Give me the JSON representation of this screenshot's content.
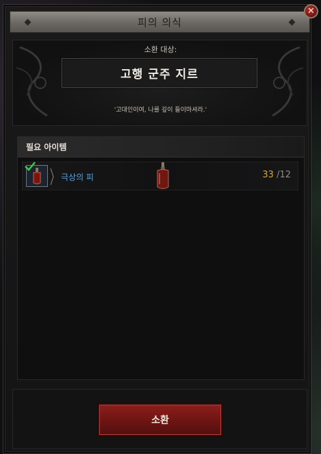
{
  "window": {
    "title": "피의 의식",
    "close_icon": "close-icon"
  },
  "summon": {
    "label": "소환 대상:",
    "target": "고행 군주 지르",
    "quote": "'고대인이여, 나를 깊이 들이마셔라.'"
  },
  "required_items": {
    "header": "필요 아이템",
    "items": [
      {
        "name": "극상의 피",
        "have": "33",
        "need": " /12",
        "status_icon": "checkmark-icon",
        "item_icon": "blood-vial-icon",
        "colors": {
          "name": "#5ba4e0",
          "have": "#d9a441"
        }
      }
    ]
  },
  "footer": {
    "summon_button": "소환"
  }
}
